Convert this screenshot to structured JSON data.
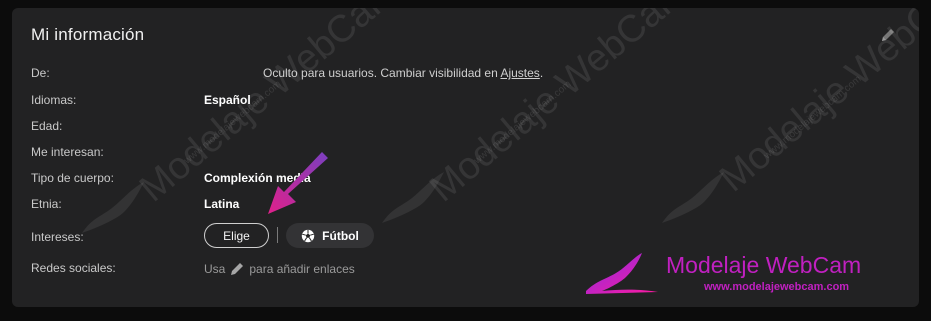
{
  "panel": {
    "title": "Mi información"
  },
  "rows": [
    {
      "label": "De:"
    },
    {
      "label": "Idiomas:",
      "value": "Español"
    },
    {
      "label": "Edad:"
    },
    {
      "label": "Me interesan:"
    },
    {
      "label": "Tipo de cuerpo:",
      "value": "Complexión media"
    },
    {
      "label": "Etnia:",
      "value": "Latina"
    },
    {
      "label": "Intereses:"
    },
    {
      "label": "Redes sociales:"
    }
  ],
  "from": {
    "text": "Oculto para usuarios. Cambiar visibilidad en ",
    "link": "Ajustes",
    "end": "."
  },
  "interests": {
    "choose_label": "Elige",
    "tag_label": "Fútbol",
    "tag_icon": "soccer-ball-icon"
  },
  "social": {
    "prefix": "Usa",
    "suffix": "para añadir enlaces",
    "icon": "pencil-icon"
  },
  "edit_icon": "pencil-icon",
  "watermark": {
    "brand": "Modelaje WebCam",
    "url": "www.modelajewebcam.com",
    "color": "#c020c0"
  },
  "colors": {
    "background": "#0c0c0c",
    "panel": "#222223",
    "accent": "#a030b0"
  }
}
